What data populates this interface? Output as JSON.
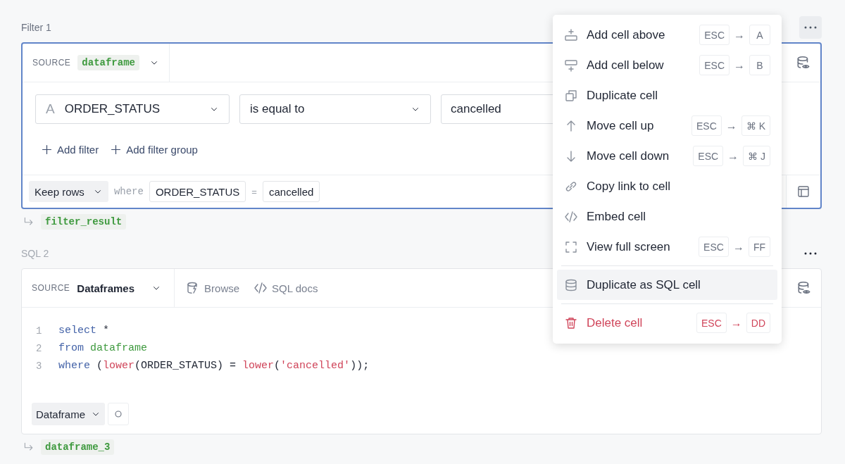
{
  "filter_cell": {
    "title": "Filter 1",
    "source_label": "SOURCE",
    "source": "dataframe",
    "filter": {
      "type_icon": "A",
      "column": "ORDER_STATUS",
      "operator": "is equal to",
      "value": "cancelled"
    },
    "add_filter": "Add filter",
    "add_filter_group": "Add filter group",
    "footer": {
      "mode": "Keep rows",
      "where": "where",
      "column": "ORDER_STATUS",
      "equals": "=",
      "value": "cancelled"
    },
    "output": "filter_result"
  },
  "sql_cell": {
    "title": "SQL 2",
    "source_label": "SOURCE",
    "source": "Dataframes",
    "browse": "Browse",
    "docs": "SQL docs",
    "lines": [
      {
        "number": "1",
        "tokens": [
          {
            "kind": "keyword",
            "text": "select"
          },
          {
            "kind": "plain",
            "text": " *"
          }
        ]
      },
      {
        "number": "2",
        "tokens": [
          {
            "kind": "keyword",
            "text": "from"
          },
          {
            "kind": "table",
            "text": "dataframe"
          }
        ]
      },
      {
        "number": "3",
        "tokens": [
          {
            "kind": "keyword",
            "text": "where"
          },
          {
            "kind": "plain",
            "text": " ("
          },
          {
            "kind": "function",
            "text": "lower"
          },
          {
            "kind": "plain",
            "text": "(ORDER_STATUS) = "
          },
          {
            "kind": "function",
            "text": "lower"
          },
          {
            "kind": "plain",
            "text": "("
          },
          {
            "kind": "string",
            "text": "'cancelled'"
          },
          {
            "kind": "plain",
            "text": "));"
          }
        ]
      }
    ],
    "result_type": "Dataframe",
    "output": "dataframe_3"
  },
  "menu": {
    "sections": [
      {
        "items": [
          {
            "label": "Add cell above",
            "kind": "normal",
            "selected": false,
            "shortcut": {
              "from": "ESC",
              "arrow": "→",
              "to": "A"
            }
          },
          {
            "label": "Add cell below",
            "kind": "normal",
            "selected": false,
            "shortcut": {
              "from": "ESC",
              "arrow": "→",
              "to": "B"
            }
          },
          {
            "label": "Duplicate cell",
            "kind": "normal",
            "selected": false
          },
          {
            "label": "Move cell up",
            "kind": "normal",
            "selected": false,
            "shortcut": {
              "from": "ESC",
              "arrow": "→",
              "to": "⌘ K"
            }
          },
          {
            "label": "Move cell down",
            "kind": "normal",
            "selected": false,
            "shortcut": {
              "from": "ESC",
              "arrow": "→",
              "to": "⌘ J"
            }
          },
          {
            "label": "Copy link to cell",
            "kind": "normal",
            "selected": false
          },
          {
            "label": "Embed cell",
            "kind": "normal",
            "selected": false
          },
          {
            "label": "View full screen",
            "kind": "normal",
            "selected": false,
            "shortcut": {
              "from": "ESC",
              "arrow": "→",
              "to": "FF"
            }
          }
        ]
      },
      {
        "items": [
          {
            "label": "Duplicate as SQL cell",
            "kind": "normal",
            "selected": true
          }
        ]
      },
      {
        "items": [
          {
            "label": "Delete cell",
            "kind": "danger",
            "selected": false,
            "shortcut": {
              "from": "ESC",
              "arrow": "→",
              "to": "DD"
            }
          }
        ]
      }
    ]
  }
}
